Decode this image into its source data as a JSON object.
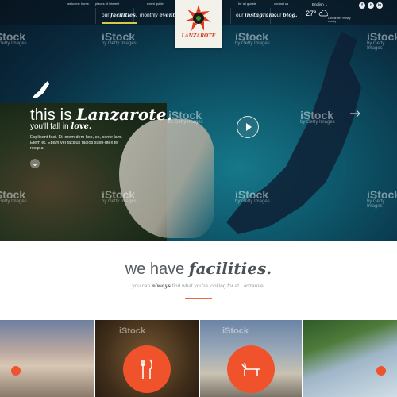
{
  "nav": {
    "top_links": [
      "welcome home.",
      "places of interest",
      "event guide",
      "for all guests",
      "contact us"
    ],
    "left_items": [
      {
        "plain": "our ",
        "strong": "facilities."
      },
      {
        "plain": "monthly ",
        "strong": "events."
      }
    ],
    "right_items": [
      {
        "plain": "our ",
        "strong": "instagram."
      },
      {
        "plain": "our ",
        "strong": "blog."
      }
    ],
    "language": "English",
    "weather": {
      "temp": "27°",
      "sub": "Lanzarote / mostly cloudy"
    },
    "social": [
      "f",
      "t",
      "in"
    ],
    "logo_text": "LANZAROTE"
  },
  "hero": {
    "title_light": "this is ",
    "title_strong": "Lanzarote.",
    "subtitle_plain": "you'll fall in ",
    "subtitle_strong": "love.",
    "body": "Explicent faci. Et lorem dem hos, es, sente lam. Etem et. Ebam vel facilius facioti susti-utex te recip a."
  },
  "watermark": {
    "brand": "iStock",
    "sub": "by Getty Images"
  },
  "facilities": {
    "title_plain": "we have ",
    "title_strong": "facilities.",
    "sub_pre": "you can ",
    "sub_strong": "always",
    "sub_post": " find what you're looking for at Lanzarote."
  },
  "colors": {
    "accent": "#f0532b",
    "nav_underline": "#d8c84a",
    "rule": "#ec6a3d"
  }
}
